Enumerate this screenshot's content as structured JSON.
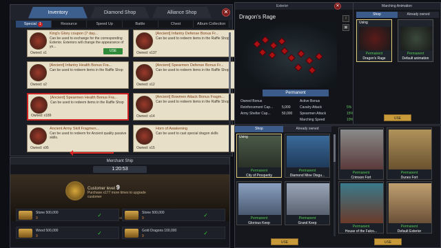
{
  "inventory": {
    "tabs": [
      "Inventory",
      "Diamond Shop",
      "Alliance Shop"
    ],
    "active_tab": "Inventory",
    "close": "✕",
    "subtabs": [
      "Special",
      "Resource",
      "Speed Up",
      "Battle",
      "Chest",
      "Album Collection"
    ],
    "special_badge": "1",
    "items": [
      {
        "title": "King's Glory coupon (7 day...",
        "desc": "Can be used to exchange for the corresponding Exterior. Exteriors will change the appearance of yo...",
        "owned": "Owned: x1",
        "use": "USE"
      },
      {
        "title": "[Ancient] Infantry Defense Bonus Fr...",
        "desc": "Can be used to redeem items in the Raffle Shop",
        "owned": "Owned: x137"
      },
      {
        "title": "[Ancient] Infantry Health Bonus Fra...",
        "desc": "Can be used to redeem items in the Raffle Shop",
        "owned": "Owned: x2"
      },
      {
        "title": "[Ancient] Spearmen Defense Bonus Fr...",
        "desc": "Can be used to redeem items in the Raffle Shop",
        "owned": "Owned: x12"
      },
      {
        "title": "[Ancient] Spearmen Health Bonus Fra...",
        "desc": "Can be used to redeem items in the Raffle Shop",
        "owned": "Owned: x189"
      },
      {
        "title": "[Ancient] Bowmen Attack Bonus Fragm...",
        "desc": "Can be used to redeem items in the Raffle Shop",
        "owned": "Owned: x14"
      },
      {
        "title": "Ancient Army Skill Fragmen...",
        "desc": "Can be used to redeem for Ancient quality passive skills.",
        "owned": "Owned: x95"
      },
      {
        "title": "Horn of Awakening",
        "desc": "Can be used to cast special dragon skills",
        "owned": "Owned: x15"
      }
    ]
  },
  "merchant": {
    "title": "Merchant Ship",
    "timer": "1:20:53",
    "customer_level_label": "Customer level",
    "customer_level": "9",
    "purchase_text": "Purchase x177 more times to upgrade customer",
    "hint": "Higher the customer level, better the deal will be",
    "rows": [
      {
        "name": "Stone 500,000",
        "cost": "9"
      },
      {
        "name": "Stone 500,000",
        "cost": "9"
      },
      {
        "name": "Wood 500,000",
        "cost": "9"
      },
      {
        "name": "Gold Dragons 100,000",
        "cost": "9"
      }
    ]
  },
  "dragon_panel": {
    "tab_left": "Exterior",
    "tab_right": "Marching Animation",
    "title": "Dragon's Rage",
    "permanent": "Permanent",
    "owned_bonus": "Owned Bonus",
    "active_bonus": "Active Bonus",
    "owned_stats": [
      {
        "label": "Reinforcement Cap...",
        "value": "5,000"
      },
      {
        "label": "Army Shelter Cap...",
        "value": "50,000"
      }
    ],
    "active_stats": [
      {
        "label": "Cavalry Attack",
        "value": "5%"
      },
      {
        "label": "Spearmen Attack",
        "value": "15%"
      },
      {
        "label": "Marching Speed",
        "value": "10%"
      }
    ]
  },
  "march": {
    "shop": "Shop",
    "already_owned": "Already owned",
    "cards": [
      {
        "using": "Using",
        "status": "Permanent",
        "name": "Dragon's Rage"
      },
      {
        "using": "",
        "status": "Permanent",
        "name": "Default animation"
      }
    ],
    "use": "USE",
    "close": "✕"
  },
  "exterior": {
    "shop": "Shop",
    "already_owned": "Already owned",
    "cards": [
      {
        "using": "Using",
        "status": "Permanent",
        "name": "City of Prosperity"
      },
      {
        "using": "",
        "status": "Permanent",
        "name": "Diamond Mine Disgu..."
      },
      {
        "using": "",
        "status": "Permanent",
        "name": "Crimson Fort"
      },
      {
        "using": "",
        "status": "Permanent",
        "name": "Dunes Fort"
      },
      {
        "using": "",
        "status": "Permanent",
        "name": "Glorious Keep"
      },
      {
        "using": "",
        "status": "Permanent",
        "name": "Grand Keep"
      },
      {
        "using": "",
        "status": "Permanent",
        "name": "House of the Falco..."
      },
      {
        "using": "",
        "status": "Permanent",
        "name": "Default Exterior"
      }
    ],
    "use": "USE"
  }
}
